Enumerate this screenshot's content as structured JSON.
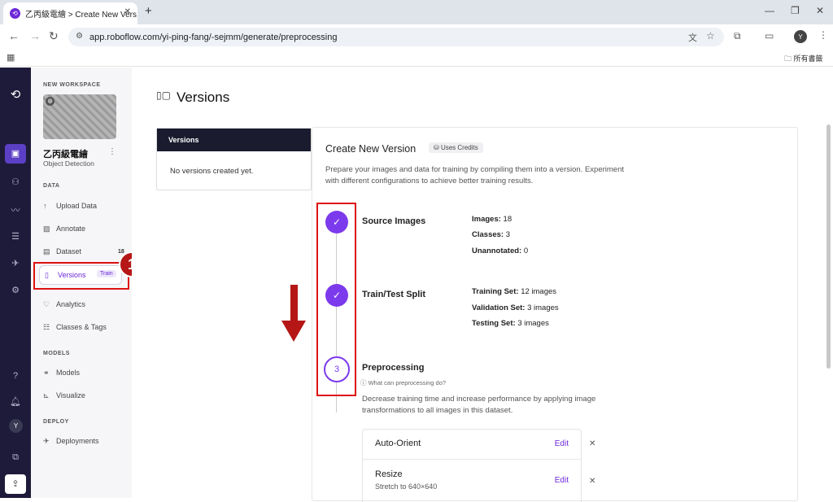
{
  "browser": {
    "tab_title": "乙丙級電繪 > Create New Vers",
    "url": "app.roboflow.com/yi-ping-fang/-sejmm/generate/preprocessing",
    "profile": "Y",
    "bookmarks_label": "所有書籤"
  },
  "sidebar": {
    "workspace_label": "NEW WORKSPACE",
    "project_name": "乙丙級電繪",
    "project_type": "Object Detection",
    "data_section": "DATA",
    "items": [
      {
        "label": "Upload Data"
      },
      {
        "label": "Annotate"
      },
      {
        "label": "Dataset",
        "badge": "18"
      },
      {
        "label": "Versions",
        "badge": "Train"
      },
      {
        "label": "Analytics"
      },
      {
        "label": "Classes & Tags"
      }
    ],
    "models_section": "MODELS",
    "model_items": [
      {
        "label": "Models"
      },
      {
        "label": "Visualize"
      }
    ],
    "deploy_section": "DEPLOY",
    "deploy_items": [
      {
        "label": "Deployments"
      }
    ],
    "user_initial": "Y"
  },
  "annotation": {
    "step_number": "1"
  },
  "main": {
    "page_title": "Versions",
    "versions_panel": {
      "header": "Versions",
      "empty": "No versions created yet."
    },
    "create": {
      "title": "Create New Version",
      "credits_badge": "Uses Credits",
      "description": "Prepare your images and data for training by compiling them into a version. Experiment with different configurations to achieve better training results.",
      "steps": [
        {
          "title": "Source Images",
          "details": [
            {
              "k": "Images:",
              "v": "18"
            },
            {
              "k": "Classes:",
              "v": "3"
            },
            {
              "k": "Unannotated:",
              "v": "0"
            }
          ]
        },
        {
          "title": "Train/Test Split",
          "details": [
            {
              "k": "Training Set:",
              "v": "12 images"
            },
            {
              "k": "Validation Set:",
              "v": "3 images"
            },
            {
              "k": "Testing Set:",
              "v": "3 images"
            }
          ]
        },
        {
          "title": "Preprocessing",
          "number": "3",
          "help": "What can preprocessing do?",
          "description": "Decrease training time and increase performance by applying image transformations to all images in this dataset."
        }
      ],
      "preprocessing_items": [
        {
          "name": "Auto-Orient",
          "action": "Edit"
        },
        {
          "name": "Resize",
          "subtitle": "Stretch to 640×640",
          "action": "Edit"
        }
      ]
    }
  },
  "colors": {
    "accent": "#7c3aed",
    "annotation_red": "#dd1111",
    "rail": "#1e1b3a"
  }
}
